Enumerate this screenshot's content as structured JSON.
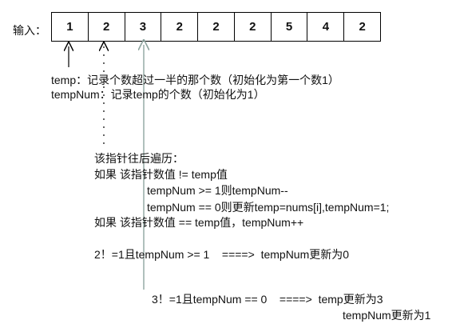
{
  "input_label": "输入：",
  "array": [
    "1",
    "2",
    "3",
    "2",
    "2",
    "2",
    "5",
    "4",
    "2"
  ],
  "temp_desc": "temp：记录个数超过一半的那个数（初始化为第一个数1）",
  "tempnum_desc": "tempNum：记录temp的个数（初始化为1）",
  "rules": {
    "intro": "该指针往后遍历：",
    "if_neq": "如果 该指针数值 != temp值",
    "case_ge1": "tempNum >= 1则tempNum--",
    "case_eq0": "tempNum == 0则更新temp=nums[i],tempNum=1;",
    "if_eq": "如果 该指针数值 == temp值，tempNum++"
  },
  "examples": {
    "ex1": "2！=1且tempNum >= 1    ====>  tempNum更新为0",
    "ex2": "3！=1且tempNum == 0    ====>  temp更新为3",
    "ex2_cont": "tempNum更新为1"
  },
  "colors": {
    "line": "#000000",
    "pointer": "#8fa5a0"
  }
}
